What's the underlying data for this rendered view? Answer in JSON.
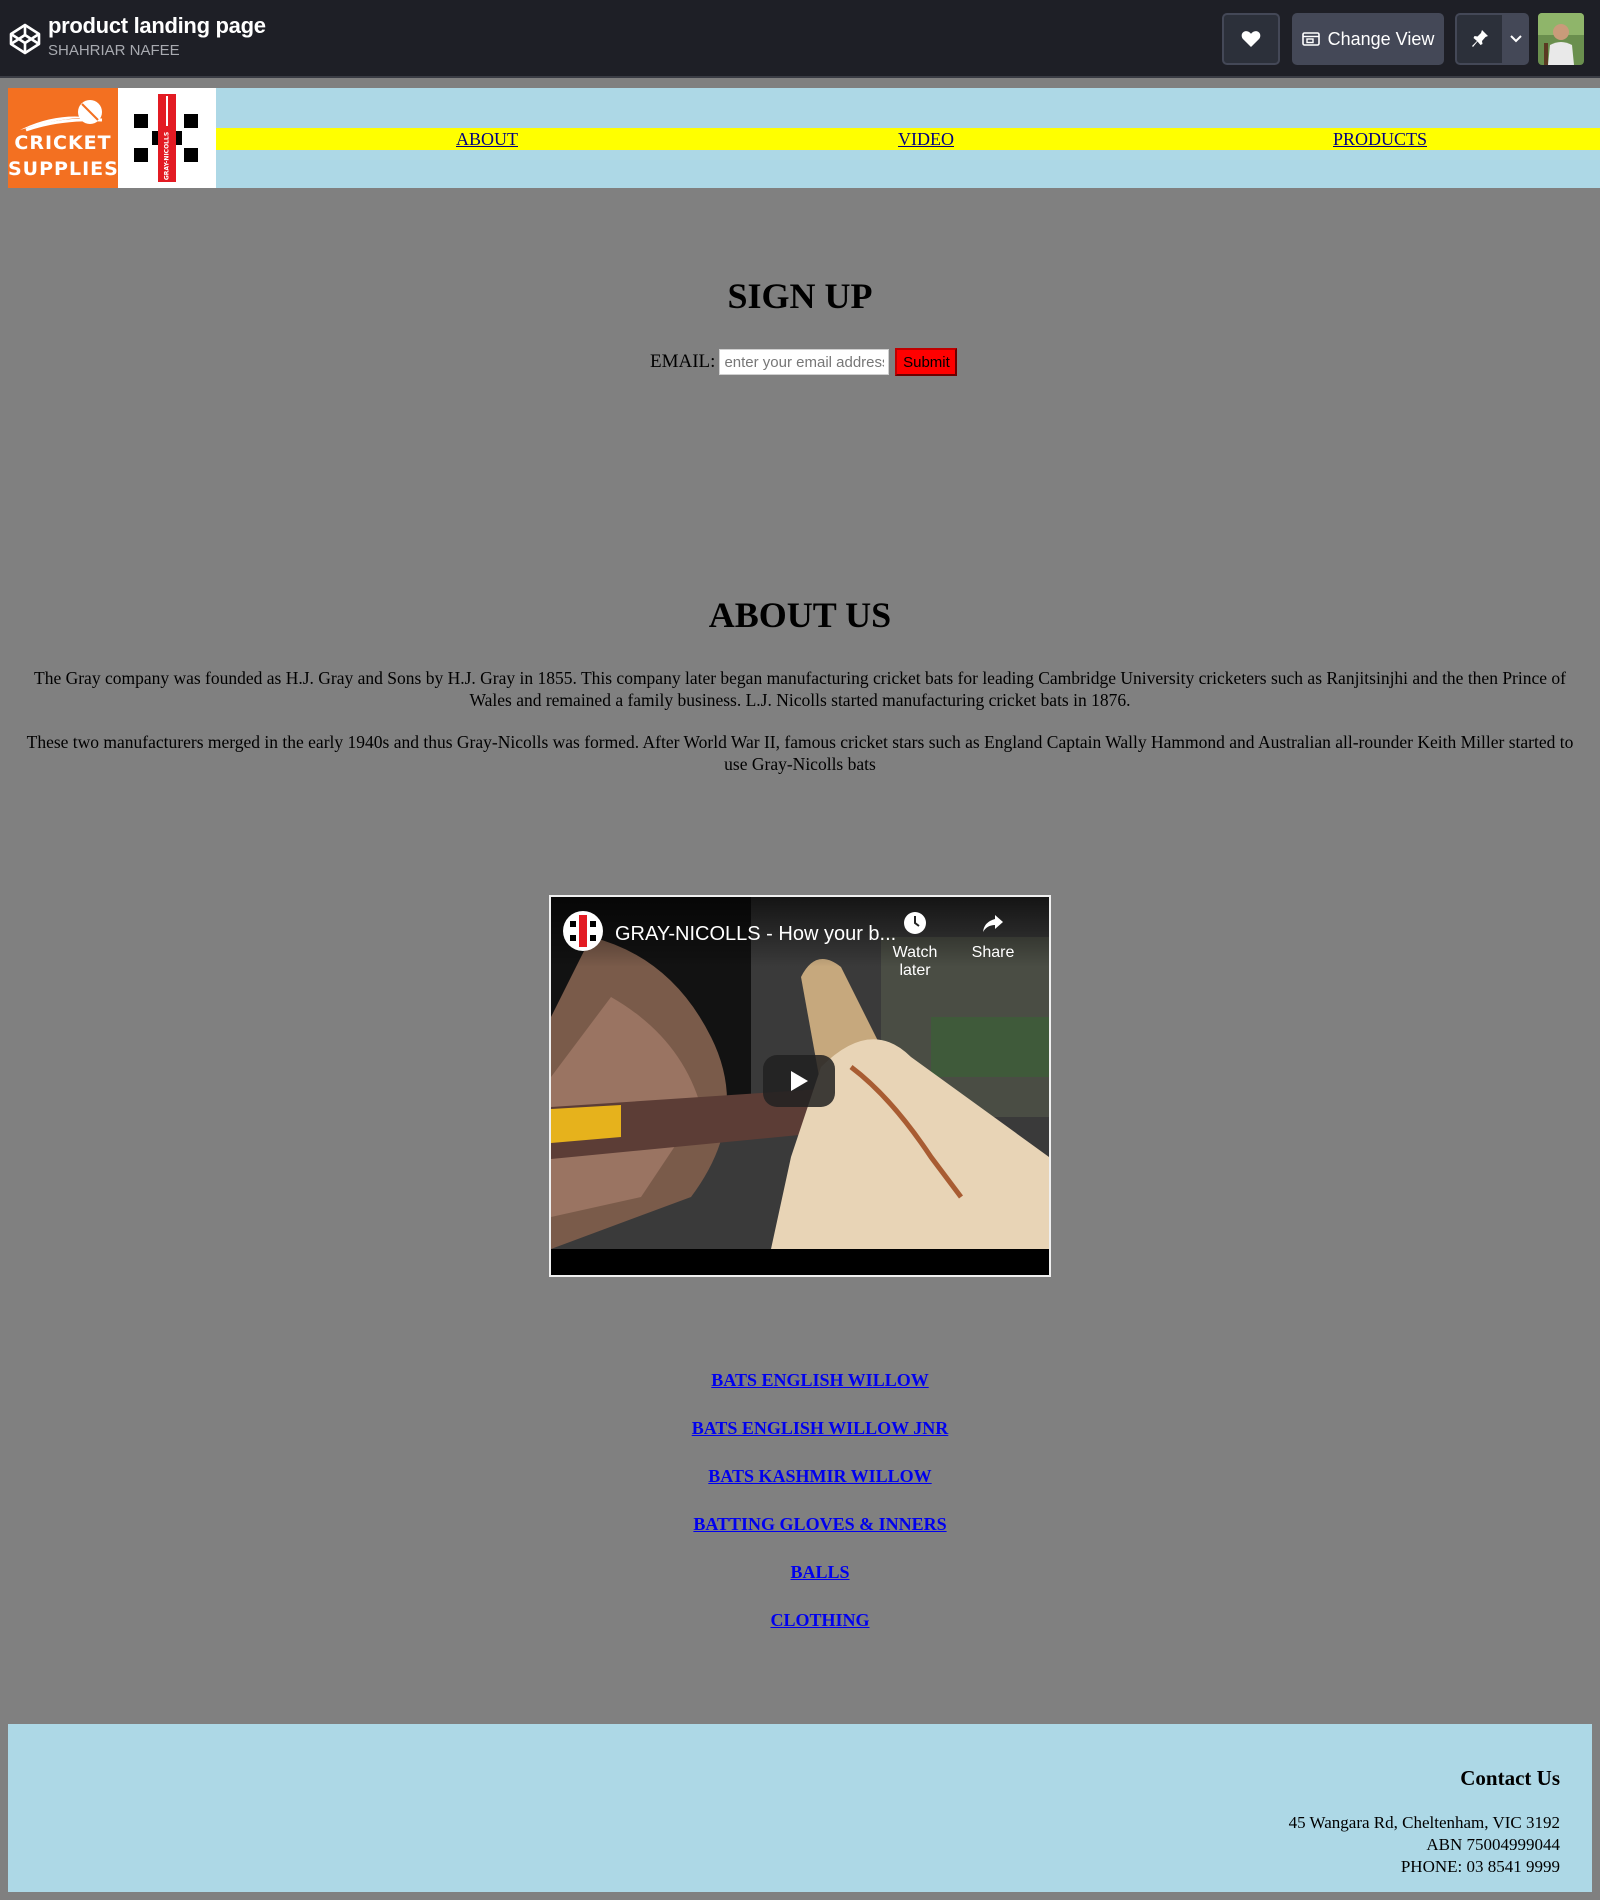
{
  "codepen": {
    "pen_title": "product landing page",
    "author": "SHAHRIAR NAFEE",
    "change_view_label": "Change View",
    "icons": [
      "codepen-logo-icon",
      "heart-icon",
      "change-view-icon",
      "pin-icon",
      "chevron-down-icon"
    ]
  },
  "header": {
    "logo_text_line1": "CRICKET",
    "logo_text_line2": "SUPPLIES",
    "brand_logo_text": "GRAY-NICOLLS",
    "nav": [
      {
        "label": "ABOUT"
      },
      {
        "label": "VIDEO"
      },
      {
        "label": "PRODUCTS"
      }
    ],
    "colors": {
      "nav_bar": "#ffff00",
      "header_bg": "#add8e6",
      "logo_orange": "#f37021"
    }
  },
  "signup": {
    "title": "SIGN UP",
    "email_label": "EMAIL:",
    "email_placeholder": "enter your email address",
    "submit_label": "Submit"
  },
  "about": {
    "title": "ABOUT US",
    "paragraphs": [
      "The Gray company was founded as H.J. Gray and Sons by H.J. Gray in 1855. This company later began manufacturing cricket bats for leading Cambridge University cricketers such as Ranjitsinjhi and the then Prince of Wales and remained a family business. L.J. Nicolls started manufacturing cricket bats in 1876.",
      "These two manufacturers merged in the early 1940s and thus Gray-Nicolls was formed. After World War II, famous cricket stars such as England Captain Wally Hammond and Australian all-rounder Keith Miller started to use Gray-Nicolls bats"
    ]
  },
  "video": {
    "title": "GRAY-NICOLLS - How your b...",
    "watch_later": "Watch later",
    "share": "Share"
  },
  "products": [
    {
      "label": "BATS ENGLISH WILLOW"
    },
    {
      "label": "BATS ENGLISH WILLOW JNR"
    },
    {
      "label": "BATS KASHMIR WILLOW"
    },
    {
      "label": "BATTING GLOVES & INNERS"
    },
    {
      "label": "BALLS"
    },
    {
      "label": "CLOTHING"
    }
  ],
  "footer": {
    "title": "Contact Us",
    "address": "45 Wangara Rd, Cheltenham, VIC 3192",
    "abn": "ABN 75004999044",
    "phone": "PHONE: 03 8541 9999"
  }
}
